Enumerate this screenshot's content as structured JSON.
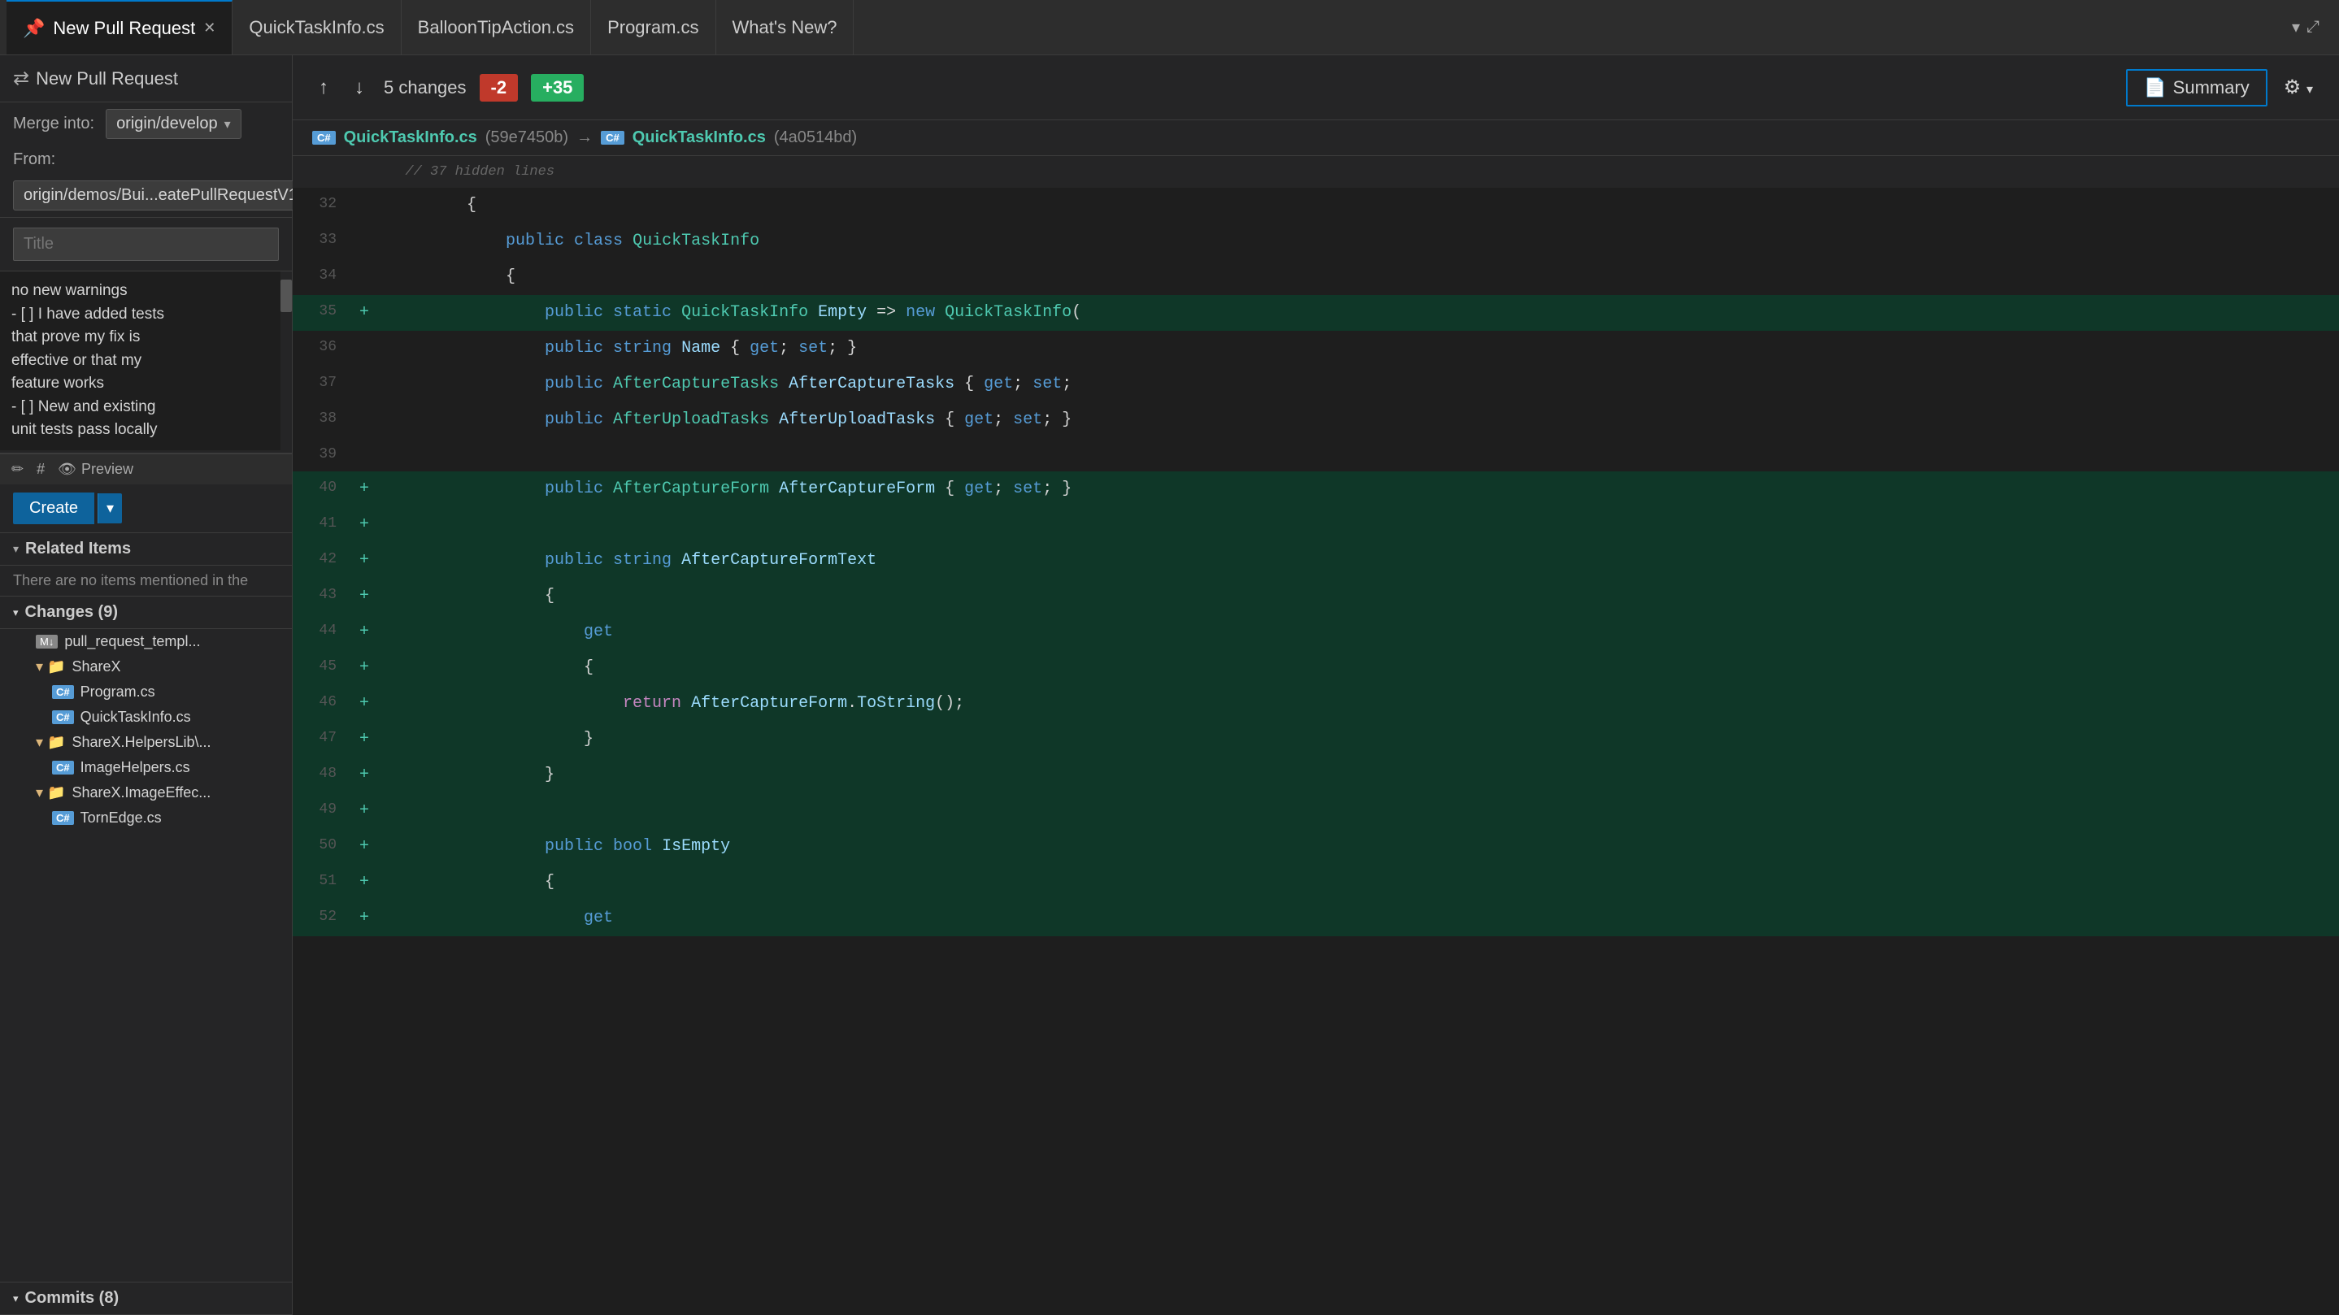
{
  "tabs": [
    {
      "id": "new-pr",
      "label": "New Pull Request",
      "active": true,
      "pinned": true,
      "closeable": true
    },
    {
      "id": "quicktask",
      "label": "QuickTaskInfo.cs",
      "active": false
    },
    {
      "id": "balloon",
      "label": "BalloonTipAction.cs",
      "active": false
    },
    {
      "id": "program",
      "label": "Program.cs",
      "active": false
    },
    {
      "id": "whats-new",
      "label": "What's New?",
      "active": false
    }
  ],
  "pr_header": {
    "icon": "⇄",
    "title": "New Pull Request",
    "merge_into_label": "Merge into:",
    "merge_branch": "origin/develop",
    "from_label": "From:",
    "from_branch": "origin/demos/Bui...eatePullRequestV1"
  },
  "title_placeholder": "Title",
  "description_text": "no new warnings\n- [ ] I have added tests\nthat prove my fix is\neffective or that my\nfeature works\n- [ ] New and existing\nunit tests pass locally",
  "toolbar": {
    "edit_icon": "✏",
    "hash_icon": "#",
    "preview_icon": "👁",
    "preview_label": "Preview"
  },
  "create_btn_label": "Create",
  "diff_header": {
    "up_arrow": "↑",
    "down_arrow": "↓",
    "changes_label": "5 changes",
    "removed_badge": "-2",
    "added_badge": "+35",
    "summary_icon": "📄",
    "summary_label": "Summary",
    "settings_icon": "⚙"
  },
  "file_diff": {
    "left_badge": "C#",
    "left_filename": "QuickTaskInfo.cs",
    "left_hash": "(59e7450b)",
    "arrow": "→",
    "right_badge": "C#",
    "right_filename": "QuickTaskInfo.cs",
    "right_hash": "(4a0514bd)"
  },
  "diff_lines": [
    {
      "num": "",
      "sign": "",
      "code": "    // 37 hidden lines",
      "type": "hidden-lines"
    },
    {
      "num": "32",
      "sign": "",
      "code": "        {",
      "type": "context"
    },
    {
      "num": "33",
      "sign": "",
      "code": "            public class QuickTaskInfo",
      "type": "context"
    },
    {
      "num": "34",
      "sign": "",
      "code": "            {",
      "type": "context"
    },
    {
      "num": "35",
      "sign": "+",
      "code": "                public static QuickTaskInfo Empty => new QuickTaskInfo(",
      "type": "added"
    },
    {
      "num": "36",
      "sign": "",
      "code": "                public string Name { get; set; }",
      "type": "context"
    },
    {
      "num": "37",
      "sign": "",
      "code": "                public AfterCaptureTasks AfterCaptureTasks { get; set;",
      "type": "context"
    },
    {
      "num": "38",
      "sign": "",
      "code": "                public AfterUploadTasks AfterUploadTasks { get; set; }",
      "type": "context"
    },
    {
      "num": "39",
      "sign": "",
      "code": "",
      "type": "context"
    },
    {
      "num": "40",
      "sign": "+",
      "code": "                public AfterCaptureForm AfterCaptureForm { get; set; }",
      "type": "added"
    },
    {
      "num": "41",
      "sign": "+",
      "code": "",
      "type": "added"
    },
    {
      "num": "42",
      "sign": "+",
      "code": "                public string AfterCaptureFormText",
      "type": "added"
    },
    {
      "num": "43",
      "sign": "+",
      "code": "                {",
      "type": "added"
    },
    {
      "num": "44",
      "sign": "+",
      "code": "                    get",
      "type": "added"
    },
    {
      "num": "45",
      "sign": "+",
      "code": "                    {",
      "type": "added"
    },
    {
      "num": "46",
      "sign": "+",
      "code": "                        return AfterCaptureForm.ToString();",
      "type": "added"
    },
    {
      "num": "47",
      "sign": "+",
      "code": "                    }",
      "type": "added"
    },
    {
      "num": "48",
      "sign": "+",
      "code": "                }",
      "type": "added"
    },
    {
      "num": "49",
      "sign": "+",
      "code": "",
      "type": "added"
    },
    {
      "num": "50",
      "sign": "+",
      "code": "                public bool IsEmpty",
      "type": "added"
    },
    {
      "num": "51",
      "sign": "+",
      "code": "                {",
      "type": "added"
    },
    {
      "num": "52",
      "sign": "+",
      "code": "                    get",
      "type": "added"
    }
  ],
  "related_items": {
    "header": "Related Items",
    "content": "There are no items mentioned in the"
  },
  "changes": {
    "header": "Changes (9)",
    "items": [
      {
        "type": "file",
        "badge": "md",
        "name": "pull_request_templ...",
        "indent": 0
      },
      {
        "type": "folder",
        "name": "ShareX",
        "indent": 0,
        "expanded": true
      },
      {
        "type": "file",
        "badge": "cs",
        "name": "Program.cs",
        "indent": 1
      },
      {
        "type": "file",
        "badge": "cs",
        "name": "QuickTaskInfo.cs",
        "indent": 1
      },
      {
        "type": "folder",
        "name": "ShareX.HelpersLib\\...",
        "indent": 0,
        "expanded": true
      },
      {
        "type": "file",
        "badge": "cs",
        "name": "ImageHelpers.cs",
        "indent": 1
      },
      {
        "type": "folder",
        "name": "ShareX.ImageEffec...",
        "indent": 0,
        "expanded": true
      },
      {
        "type": "file",
        "badge": "cs",
        "name": "TornEdge.cs",
        "indent": 1
      }
    ]
  },
  "commits": {
    "header": "Commits (8)"
  }
}
